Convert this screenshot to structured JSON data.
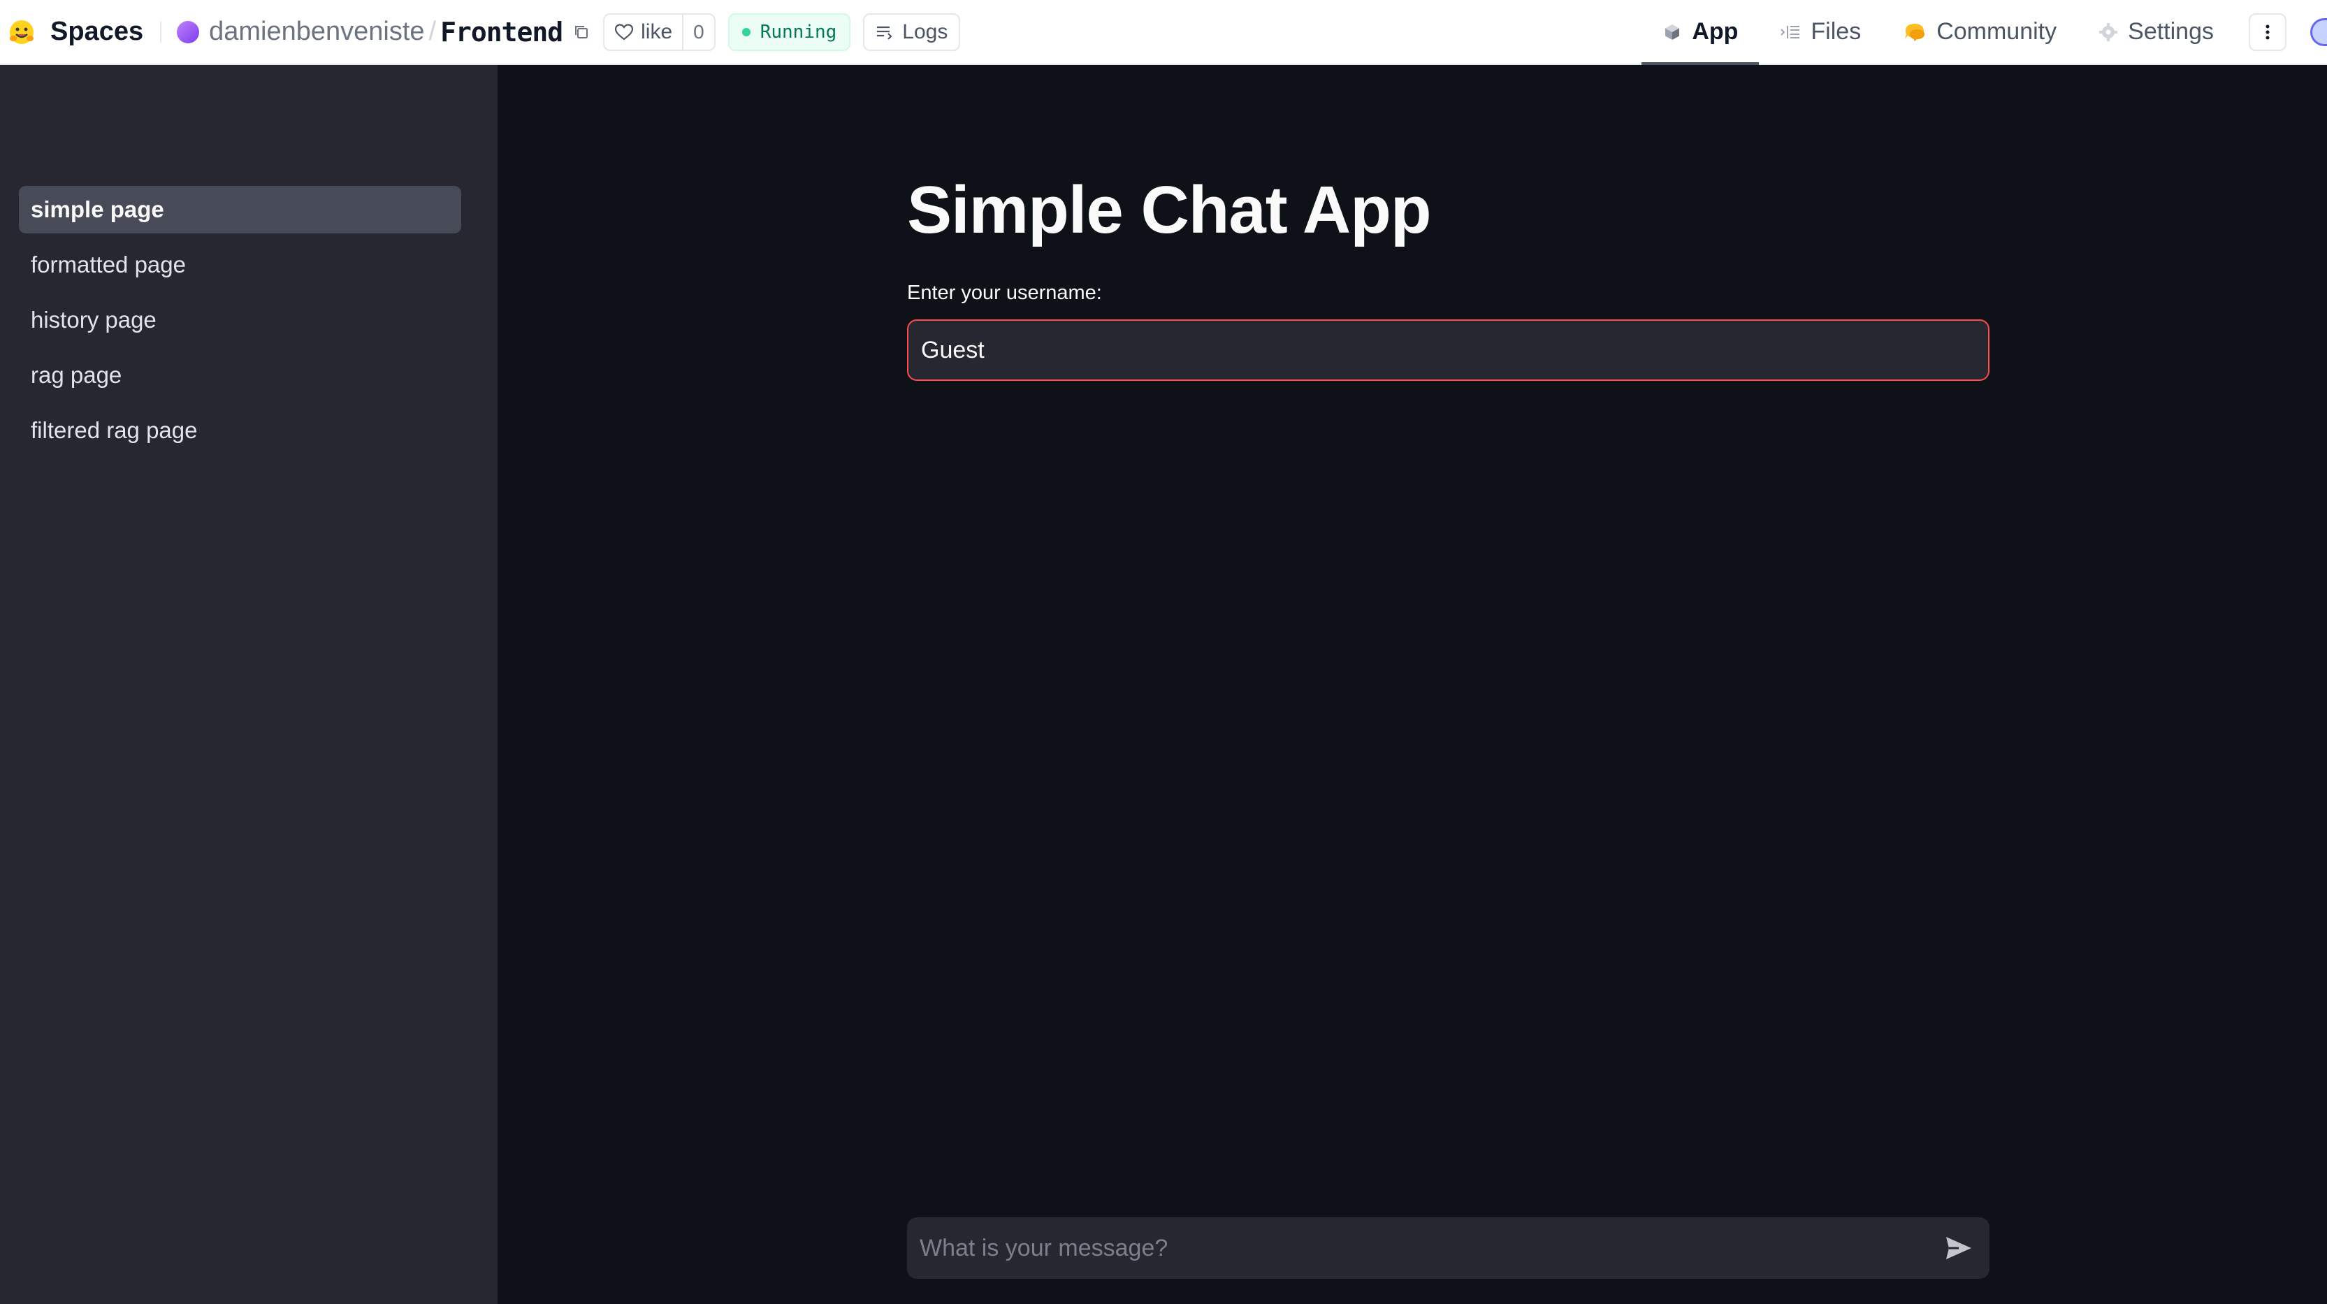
{
  "header": {
    "brand": "Spaces",
    "owner": "damienbenveniste",
    "separator": "/",
    "repo": "Frontend",
    "like_label": "like",
    "like_count": "0",
    "status": "Running",
    "logs_label": "Logs",
    "tabs": [
      {
        "label": "App",
        "icon": "app-icon",
        "active": true
      },
      {
        "label": "Files",
        "icon": "files-icon",
        "active": false
      },
      {
        "label": "Community",
        "icon": "community-icon",
        "active": false
      },
      {
        "label": "Settings",
        "icon": "gear-icon",
        "active": false
      }
    ]
  },
  "sidebar": {
    "items": [
      {
        "label": "simple page",
        "active": true
      },
      {
        "label": "formatted page",
        "active": false
      },
      {
        "label": "history page",
        "active": false
      },
      {
        "label": "rag page",
        "active": false
      },
      {
        "label": "filtered rag page",
        "active": false
      }
    ]
  },
  "main": {
    "title": "Simple Chat App",
    "username_label": "Enter your username:",
    "username_value": "Guest",
    "chat_placeholder": "What is your message?"
  },
  "colors": {
    "accent": "#ff4b4b",
    "background": "#0e1117",
    "sidebar": "#262730",
    "status_green": "#047857"
  }
}
